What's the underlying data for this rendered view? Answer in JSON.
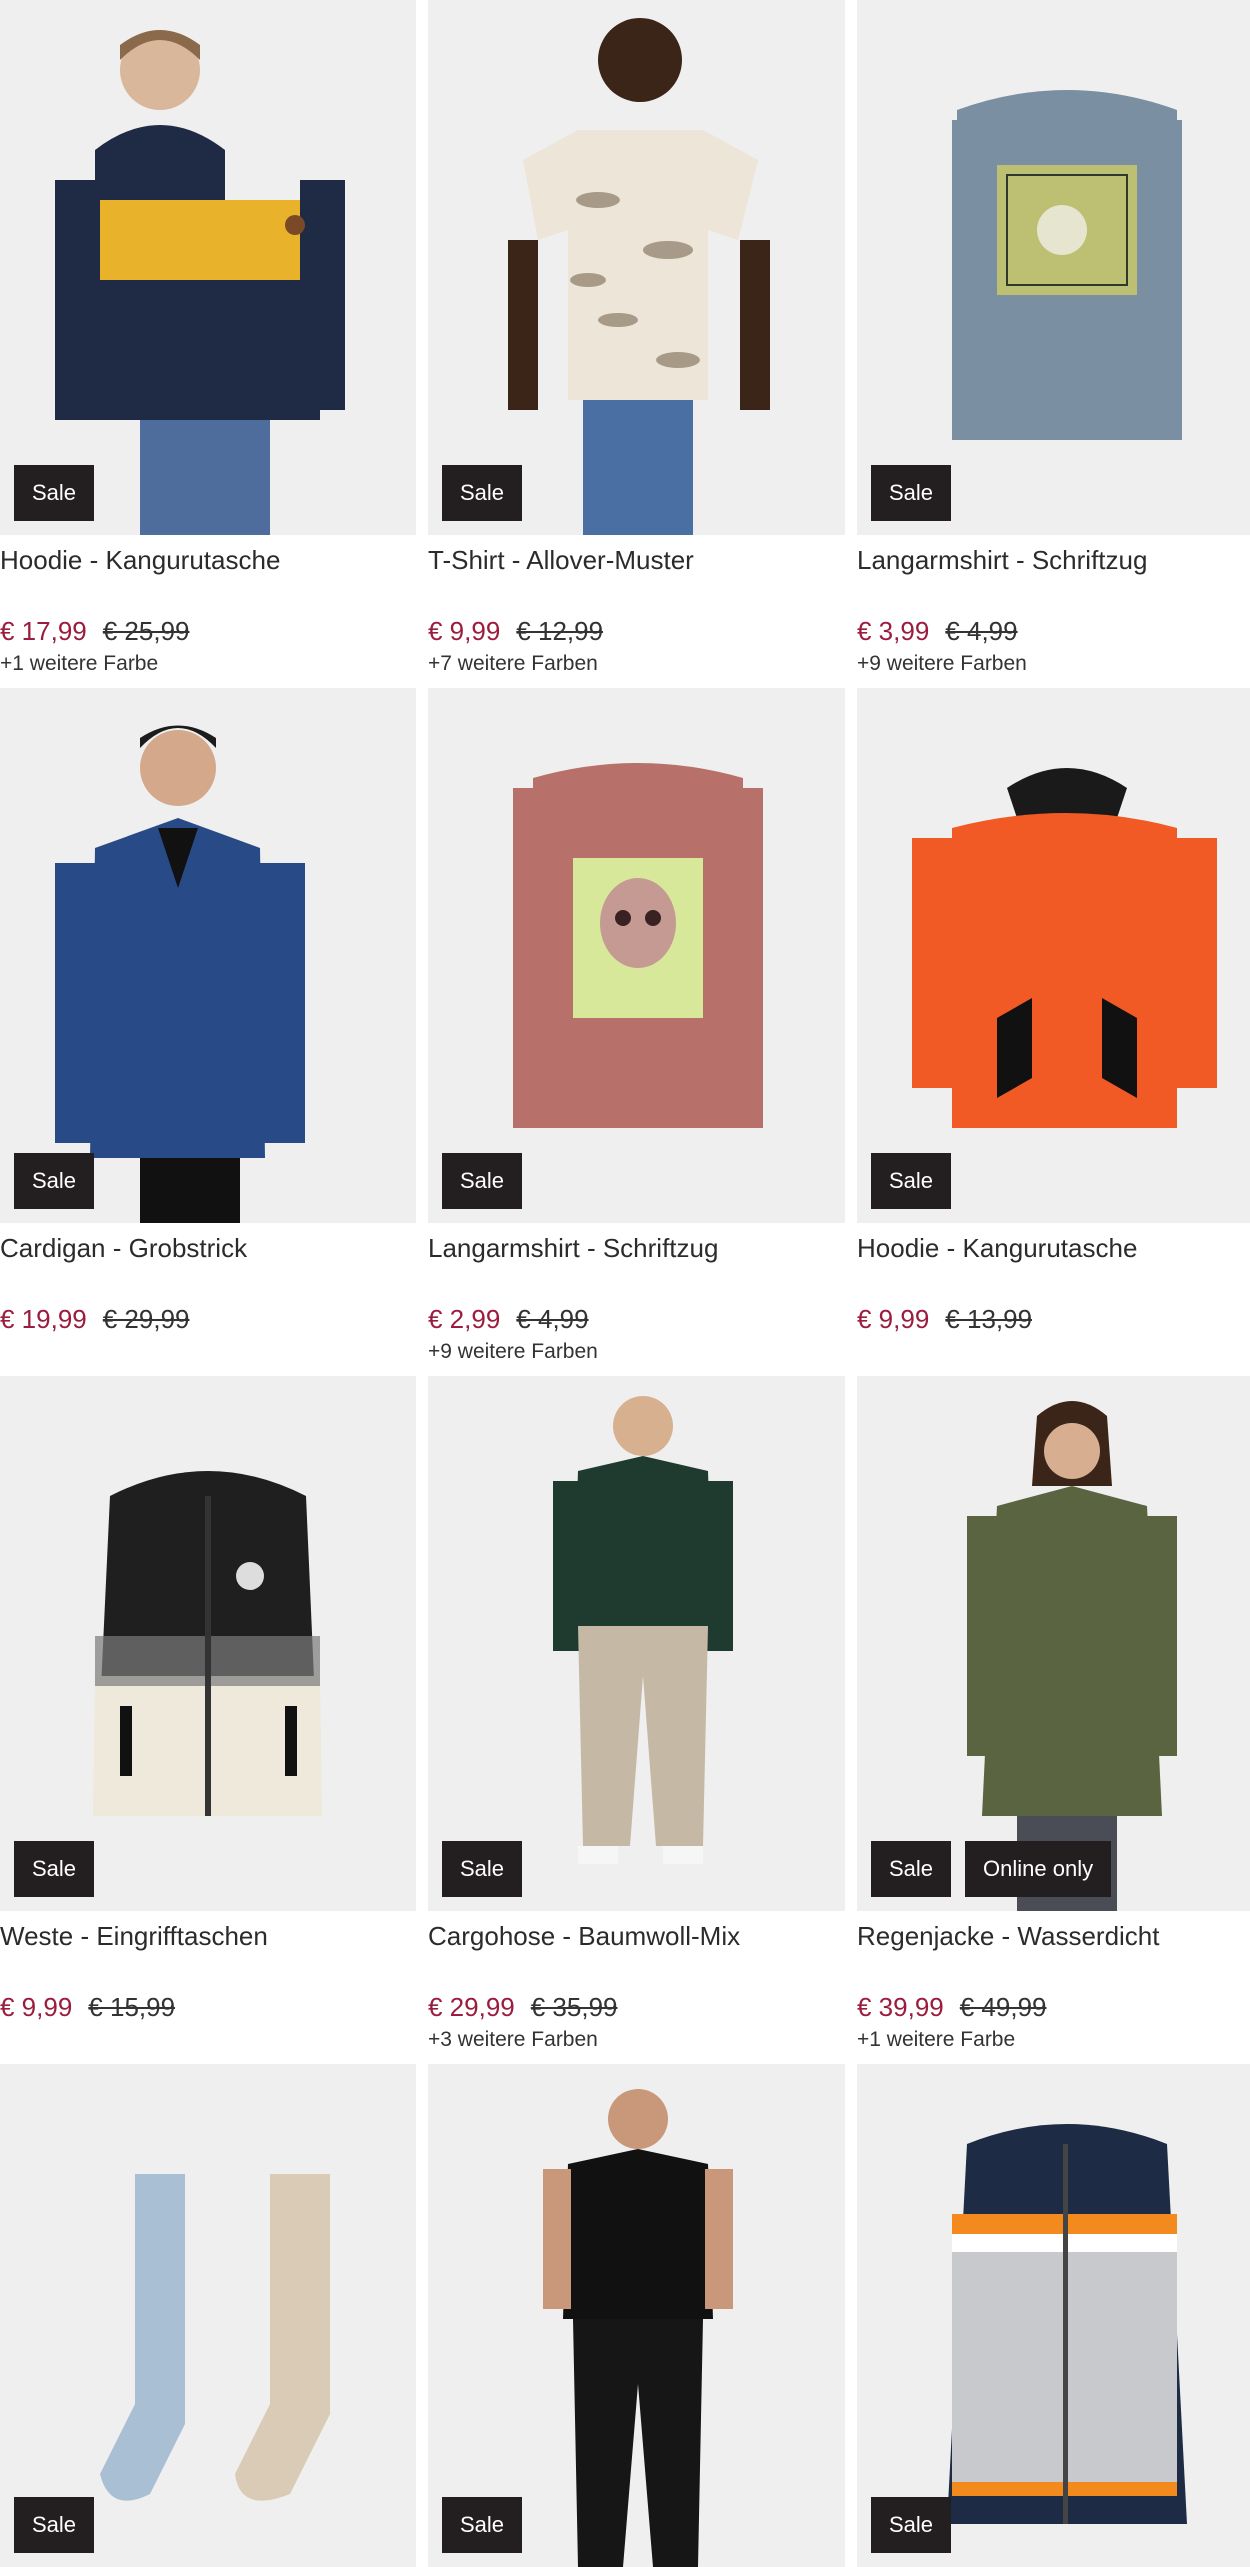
{
  "products": [
    {
      "name": "Hoodie - Kangurutasche",
      "price": "€ 17,99",
      "old_price": "€ 25,99",
      "colors": "+1 weitere Farbe",
      "badges": [
        "Sale"
      ],
      "image": "hoodie-navy-yellow"
    },
    {
      "name": "T-Shirt - Allover-Muster",
      "price": "€ 9,99",
      "old_price": "€ 12,99",
      "colors": "+7 weitere Farben",
      "badges": [
        "Sale"
      ],
      "image": "tshirt-leaf-print"
    },
    {
      "name": "Langarmshirt - Schriftzug",
      "price": "€ 3,99",
      "old_price": "€ 4,99",
      "colors": "+9 weitere Farben",
      "badges": [
        "Sale"
      ],
      "image": "longsleeve-blue-print"
    },
    {
      "name": "Cardigan - Grobstrick",
      "price": "€ 19,99",
      "old_price": "€ 29,99",
      "colors": "",
      "badges": [
        "Sale"
      ],
      "image": "cardigan-blue"
    },
    {
      "name": "Langarmshirt - Schriftzug",
      "price": "€ 2,99",
      "old_price": "€ 4,99",
      "colors": "+9 weitere Farben",
      "badges": [
        "Sale"
      ],
      "image": "longsleeve-pink-skull"
    },
    {
      "name": "Hoodie - Kangurutasche",
      "price": "€ 9,99",
      "old_price": "€ 13,99",
      "colors": "",
      "badges": [
        "Sale"
      ],
      "image": "hoodie-orange"
    },
    {
      "name": "Weste - Eingrifftaschen",
      "price": "€ 9,99",
      "old_price": "€ 15,99",
      "colors": "",
      "badges": [
        "Sale"
      ],
      "image": "vest-black-white"
    },
    {
      "name": "Cargohose - Baumwoll-Mix",
      "price": "€ 29,99",
      "old_price": "€ 35,99",
      "colors": "+3 weitere Farben",
      "badges": [
        "Sale"
      ],
      "image": "cargo-pants-beige"
    },
    {
      "name": "Regenjacke - Wasserdicht",
      "price": "€ 39,99",
      "old_price": "€ 49,99",
      "colors": "+1 weitere Farbe",
      "badges": [
        "Sale",
        "Online only"
      ],
      "image": "raincoat-olive"
    },
    {
      "name": "",
      "price": "",
      "old_price": "",
      "colors": "",
      "badges": [
        "Sale"
      ],
      "image": "tights-blue-beige"
    },
    {
      "name": "",
      "price": "",
      "old_price": "",
      "colors": "",
      "badges": [
        "Sale"
      ],
      "image": "black-tee-pants"
    },
    {
      "name": "",
      "price": "",
      "old_price": "",
      "colors": "",
      "badges": [
        "Sale"
      ],
      "image": "kids-jacket-navy"
    }
  ],
  "colors": {
    "price": "#9b1c3e",
    "badge_bg": "#231f20",
    "image_bg": "#efefef"
  }
}
